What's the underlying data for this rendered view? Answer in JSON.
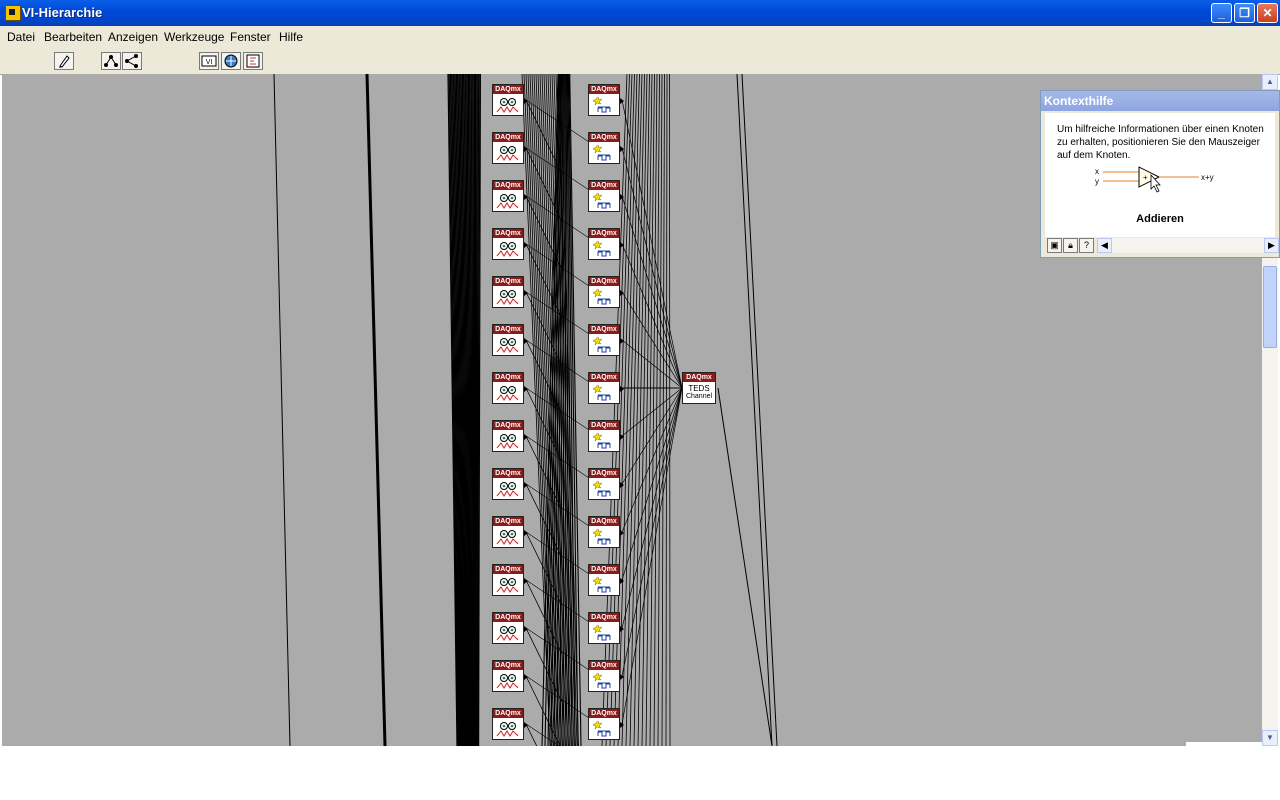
{
  "window": {
    "title": "VI-Hierarchie",
    "minimize": "_",
    "maximize": "❐",
    "close": "✕"
  },
  "menu": {
    "items": [
      {
        "label": "Datei"
      },
      {
        "label": "Bearbeiten"
      },
      {
        "label": "Anzeigen"
      },
      {
        "label": "Werkzeuge"
      },
      {
        "label": "Fenster"
      },
      {
        "label": "Hilfe"
      }
    ]
  },
  "toolbar": {
    "buttons": [
      {
        "name": "redraw-icon"
      },
      {
        "name": "vertical-layout-icon"
      },
      {
        "name": "horizontal-layout-icon"
      },
      {
        "name": "include-vilib-icon"
      },
      {
        "name": "include-globals-icon"
      },
      {
        "name": "include-typedefs-icon"
      }
    ]
  },
  "graph": {
    "node_header": "DAQmx",
    "teds_node": {
      "header": "DAQmx",
      "line1": "TEDS",
      "line2": "Channel"
    }
  },
  "context_help": {
    "title": "Kontexthilfe",
    "text": "Um hilfreiche Informationen über einen Knoten zu erhalten, positionieren Sie den Mauszeiger auf dem Knoten.",
    "diagram": {
      "input_x": "x",
      "input_y": "y",
      "output": "x+y"
    },
    "function_name": "Addieren"
  },
  "colors": {
    "canvas": "#ababab",
    "node_header": "#8b1a1a",
    "titlebar": "#0049d8"
  }
}
